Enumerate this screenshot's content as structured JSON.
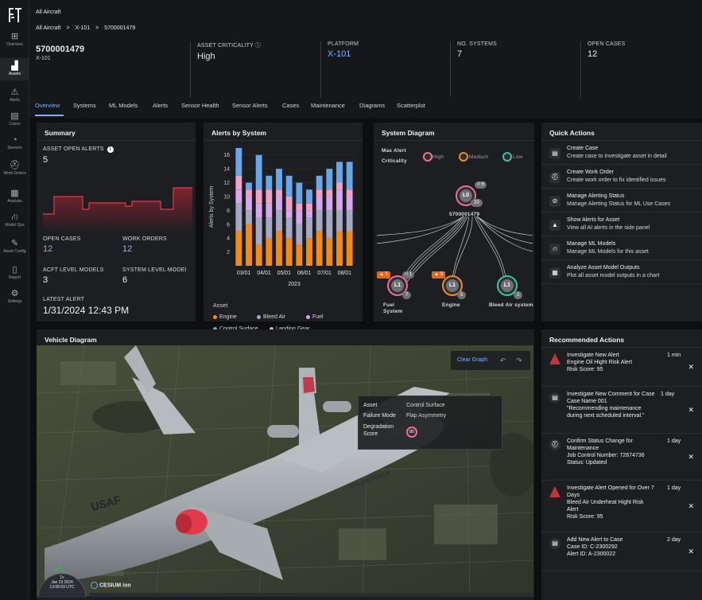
{
  "nav": {
    "items": [
      {
        "label": "Overview",
        "icon": "grid-icon"
      },
      {
        "label": "Assets",
        "icon": "chart-icon"
      },
      {
        "label": "Alerts",
        "icon": "warning-icon"
      },
      {
        "label": "Cases",
        "icon": "briefcase-icon"
      },
      {
        "label": "Sensors",
        "icon": "gauge-icon"
      },
      {
        "label": "Work Orders",
        "icon": "hardhat-icon"
      },
      {
        "label": "Analysis",
        "icon": "analysis-icon"
      },
      {
        "label": "Model Ops",
        "icon": "model-icon"
      },
      {
        "label": "Asset Config",
        "icon": "wrench-icon"
      },
      {
        "label": "Report",
        "icon": "document-icon"
      },
      {
        "label": "Settings",
        "icon": "gear-icon"
      }
    ]
  },
  "header": {
    "title": "All Aircraft",
    "breadcrumb": [
      "All Aircraft",
      ">",
      "X-101",
      ">",
      "5700001479"
    ],
    "asset_id": "5700001479",
    "asset_sub": "X-101",
    "kpis": [
      {
        "label": "ASSET CRITICALITY ⓘ",
        "value": "High"
      },
      {
        "label": "PLATFORM",
        "value": "X-101"
      },
      {
        "label": "NO. SYSTEMS",
        "value": "7"
      },
      {
        "label": "OPEN CASES",
        "value": "12"
      }
    ]
  },
  "tabs": [
    "Overview",
    "Systems",
    "ML Models",
    "Alerts",
    "Sensor Health",
    "Sensor Alerts",
    "Cases",
    "Maintenance",
    "Diagrams",
    "Scatterplot"
  ],
  "summary": {
    "title": "Summary",
    "open_alerts_label": "ASSET OPEN ALERTS",
    "open_alerts_value": "5",
    "open_cases_label": "OPEN CASES",
    "open_cases_value": "12",
    "work_orders_label": "WORK ORDERS",
    "work_orders_value": "12",
    "acft_models_label": "ACFT LEVEL MODELS",
    "acft_models_value": "3",
    "system_models_label": "SYSTEM LEVEL MODEI",
    "system_models_value": "6",
    "latest_alert_label": "LATEST ALERT",
    "latest_alert_value": "1/31/2024 12:43 PM"
  },
  "alerts_chart": {
    "title": "Alerts by System",
    "legend_title": "Asset",
    "colors": {
      "Engine": "#f28c18",
      "Bleed Air": "#a7a9c4",
      "Fuel": "#d7a8f0",
      "Control Surface": "#6aa7ea",
      "Landing Gear": "#f4a3c6"
    }
  },
  "chart_data": {
    "type": "bar",
    "stacked": true,
    "title": "Alerts by System",
    "ylabel": "Alerts by System",
    "xlabel": "2023",
    "ylim": [
      0,
      17
    ],
    "yticks": [
      2,
      4,
      6,
      8,
      10,
      12,
      14,
      16
    ],
    "x_tick_labels": [
      "03/01",
      "04/01",
      "05/01",
      "06/01",
      "07/01",
      "08/01"
    ],
    "categories": [
      "03/01",
      "",
      "04/01",
      "",
      "05/01",
      "",
      "06/01",
      "",
      "07/01",
      "",
      "08/01",
      ""
    ],
    "series": [
      {
        "name": "Engine",
        "values": [
          5,
          6,
          3,
          4,
          5,
          4,
          3,
          4,
          5,
          4,
          5,
          5
        ]
      },
      {
        "name": "Bleed Air",
        "values": [
          4,
          2,
          4,
          3,
          3,
          3,
          3,
          3,
          3,
          4,
          3,
          3
        ]
      },
      {
        "name": "Fuel",
        "values": [
          2,
          2,
          2,
          2,
          2,
          1,
          2,
          1,
          2,
          2,
          3,
          2
        ]
      },
      {
        "name": "Landing Gear",
        "values": [
          2,
          1,
          2,
          2,
          1,
          2,
          1,
          1,
          1,
          1,
          1,
          1
        ]
      },
      {
        "name": "Control Surface",
        "values": [
          4,
          1,
          5,
          2,
          3,
          3,
          3,
          2,
          2,
          3,
          3,
          4
        ]
      }
    ],
    "grid": true,
    "legend_position": "bottom"
  },
  "system_diagram": {
    "title": "System Diagram",
    "max_alert_label": "Max Alert",
    "criticality_label": "Criticality",
    "legend": [
      {
        "label": "High",
        "color": "#f36d8f"
      },
      {
        "label": "Medium",
        "color": "#f28c18"
      },
      {
        "label": "Low",
        "color": "#3cc3a0"
      }
    ],
    "root": {
      "label": "L0",
      "badge1": "6",
      "badge2": "20",
      "name": "5700001479"
    },
    "children": [
      {
        "label": "L1",
        "alerts": "5",
        "models": "1",
        "count": "7",
        "name1": "Fuel",
        "name2": "System",
        "ring": "#f36d8f"
      },
      {
        "label": "L1",
        "alerts": "3",
        "models": "",
        "count": "5",
        "name1": "Engine",
        "name2": "",
        "ring": "#f28c18"
      },
      {
        "label": "L1",
        "alerts": "",
        "models": "",
        "count": "2",
        "name1": "Bleed Air system",
        "name2": "",
        "ring": "#3cc3a0"
      }
    ]
  },
  "quick_actions": {
    "title": "Quick Actions",
    "items": [
      {
        "icon": "briefcase-icon",
        "title": "Create Case",
        "desc": "Create case to investigate asset in detail"
      },
      {
        "icon": "hardhat-icon",
        "title": "Create Work Order",
        "desc": "Create work order to fix identified issues"
      },
      {
        "icon": "alert-off-icon",
        "title": "Manage Alerting Status",
        "desc": "Manage Alerting Status for ML Use Cases"
      },
      {
        "icon": "warning-icon",
        "title": "Show Alerts for Asset",
        "desc": "View all AI alerts in the side panel"
      },
      {
        "icon": "model-icon",
        "title": "Manage ML Models",
        "desc": "Manage ML Models for this asset"
      },
      {
        "icon": "analysis-icon",
        "title": "Analyze Asset Model Outputs",
        "desc": "Plot all asset model outputs in a chart"
      }
    ]
  },
  "recommended": {
    "title": "Recommended Actions",
    "items": [
      {
        "icon": "alert",
        "lines": [
          "Investigate New Alert",
          "Engine Oil Hight Risk Alert",
          "Risk Score: 95"
        ],
        "time": "1 min"
      },
      {
        "icon": "briefcase",
        "lines": [
          "Investigate New Comment for Case",
          "Case Name 001",
          "\"Recommending maintenance",
          "during next scheduled interval.\""
        ],
        "time": "1 day"
      },
      {
        "icon": "hardhat",
        "lines": [
          "Confirm Status Change for",
          "Maintenance",
          "Job Control Number: 72674736",
          "Status: Updated"
        ],
        "time": "1 day"
      },
      {
        "icon": "alert",
        "lines": [
          "Investigate Alert Opened for Over 7",
          "Days",
          "Bleed Air Underheat Hight Risk",
          "Alert",
          "Risk Score: 95"
        ],
        "time": "1 day"
      },
      {
        "icon": "briefcase",
        "lines": [
          "Add New Alert to Case",
          "Case ID: C-2300292",
          "Alert ID: A-2300022"
        ],
        "time": "2 day"
      }
    ]
  },
  "vehicle": {
    "title": "Vehicle Diagram",
    "clear_label": "Clear Graph",
    "info": {
      "asset_label": "Asset",
      "asset_value": "Control Surface",
      "failure_label": "Failure Mode",
      "failure_value": "Flap Asymmetry",
      "deg_label1": "Degradation",
      "deg_label2": "Score",
      "deg_value": "80"
    },
    "clock": {
      "line1": "1x",
      "line2": "Jan 23 2024",
      "line3": "13:08:59 UTC"
    },
    "cesium": "CESIUM ion",
    "tail_text": "USAF",
    "fuselage_text": "U.S. AIR FORCE"
  }
}
